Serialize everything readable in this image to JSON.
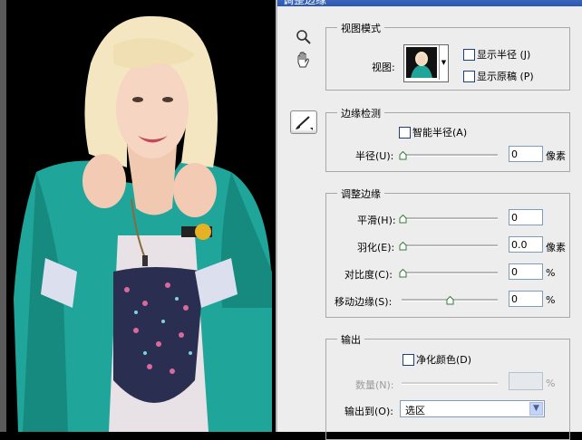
{
  "window": {
    "title": "调整边缘"
  },
  "view_mode": {
    "legend": "视图模式",
    "view_label": "视图:",
    "show_radius": "显示半径 (J)",
    "show_original": "显示原稿 (P)"
  },
  "edge_detection": {
    "legend": "边缘检测",
    "smart_radius": "智能半径(A)",
    "radius_label": "半径(U):",
    "radius_value": "0",
    "radius_unit": "像素"
  },
  "adjust_edge": {
    "legend": "调整边缘",
    "smooth_label": "平滑(H):",
    "smooth_value": "0",
    "feather_label": "羽化(E):",
    "feather_value": "0.0",
    "feather_unit": "像素",
    "contrast_label": "对比度(C):",
    "contrast_value": "0",
    "contrast_unit": "%",
    "shift_label": "移动边缘(S):",
    "shift_value": "0",
    "shift_unit": "%"
  },
  "output": {
    "legend": "输出",
    "decontaminate": "净化颜色(D)",
    "amount_label": "数量(N):",
    "amount_value": "",
    "amount_unit": "%",
    "output_to_label": "输出到(O):",
    "output_to_value": "选区"
  },
  "sliders": {
    "radius": 0,
    "smooth": 0,
    "feather": 0,
    "contrast": 0,
    "shift": 0
  },
  "colors": {
    "accent": "#2a57b1",
    "teal_jacket": "#1fa59a",
    "hair": "#f3e6c0"
  }
}
